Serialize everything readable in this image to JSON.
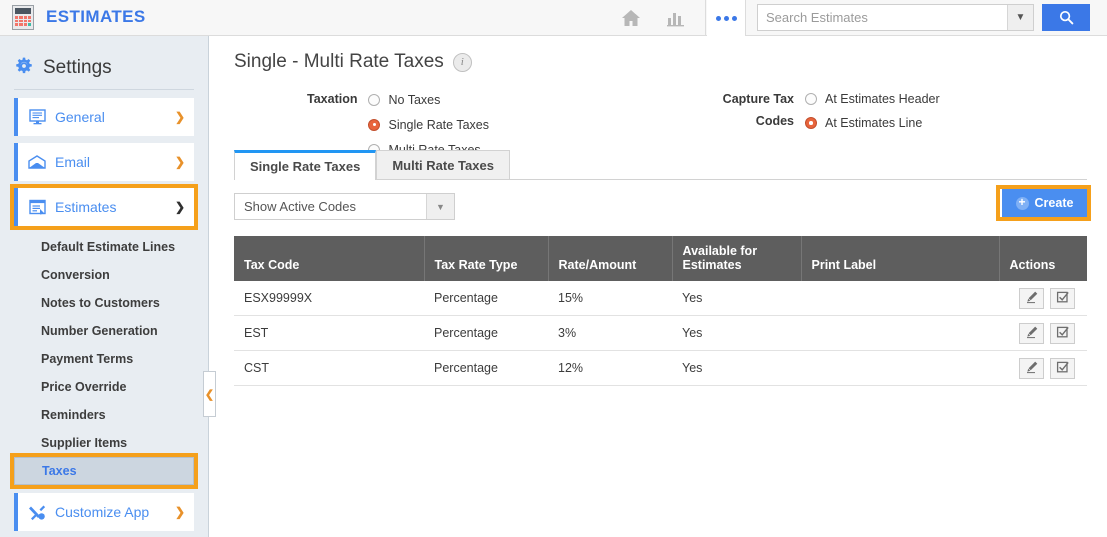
{
  "topbar": {
    "app_name": "ESTIMATES",
    "app_icon": "calculator-icon",
    "home_icon": "home-icon",
    "reports_icon": "bar-chart-icon",
    "more_icon": "more-dots-icon",
    "search": {
      "placeholder": "Search Estimates",
      "value": "",
      "dropdown_icon": "chevron-down-icon",
      "button_icon": "search-icon"
    },
    "accent_blue": "#3b78e7"
  },
  "sidebar": {
    "title": "Settings",
    "title_icon": "gear-icon",
    "nav": [
      {
        "label": "General",
        "icon": "monitor-icon",
        "arrow": "chevron-right-icon",
        "highlighted": false
      },
      {
        "label": "Email",
        "icon": "envelope-icon",
        "arrow": "chevron-right-icon",
        "highlighted": false
      },
      {
        "label": "Estimates",
        "icon": "document-form-icon",
        "arrow": "chevron-down-icon",
        "highlighted": true
      }
    ],
    "sub_items": [
      {
        "label": "Default Estimate Lines",
        "active": false
      },
      {
        "label": "Conversion",
        "active": false
      },
      {
        "label": "Notes to Customers",
        "active": false
      },
      {
        "label": "Number Generation",
        "active": false
      },
      {
        "label": "Payment Terms",
        "active": false
      },
      {
        "label": "Price Override",
        "active": false
      },
      {
        "label": "Reminders",
        "active": false
      },
      {
        "label": "Supplier Items",
        "active": false
      },
      {
        "label": "Taxes",
        "active": true
      }
    ],
    "footer_nav": {
      "label": "Customize App",
      "icon": "tools-icon",
      "arrow": "chevron-right-icon"
    },
    "collapse_icon": "chevron-left-icon",
    "highlight_color": "#f5a01b"
  },
  "main": {
    "page_title": "Single - Multi Rate Taxes",
    "info_icon": "info-icon",
    "info_glyph": "i",
    "taxation": {
      "label": "Taxation",
      "options": [
        {
          "label": "No Taxes",
          "selected": false
        },
        {
          "label": "Single Rate Taxes",
          "selected": true
        },
        {
          "label": "Multi Rate Taxes",
          "selected": false
        }
      ]
    },
    "capture_tax_codes": {
      "label_line1": "Capture Tax",
      "label_line2": "Codes",
      "options": [
        {
          "label": "At Estimates Header",
          "selected": false
        },
        {
          "label": "At Estimates Line",
          "selected": true
        }
      ]
    },
    "tabs": [
      {
        "label": "Single Rate Taxes",
        "active": true
      },
      {
        "label": "Multi Rate Taxes",
        "active": false
      }
    ],
    "filter": {
      "value": "Show Active Codes",
      "caret_icon": "caret-down-icon"
    },
    "create_button": {
      "label": "Create",
      "icon": "plus-circle-icon",
      "highlighted": true
    },
    "table": {
      "columns": [
        "Tax Code",
        "Tax Rate Type",
        "Rate/Amount",
        "Available for Estimates",
        "Print Label",
        "Actions"
      ],
      "column_avail_line1": "Available for",
      "column_avail_line2": "Estimates",
      "rows": [
        {
          "tax_code": "ESX99999X",
          "tax_rate_type": "Percentage",
          "rate_amount": "15%",
          "available": "Yes",
          "print_label": ""
        },
        {
          "tax_code": "EST",
          "tax_rate_type": "Percentage",
          "rate_amount": "3%",
          "available": "Yes",
          "print_label": ""
        },
        {
          "tax_code": "CST",
          "tax_rate_type": "Percentage",
          "rate_amount": "12%",
          "available": "Yes",
          "print_label": ""
        }
      ],
      "row_actions": [
        {
          "icon": "pencil-edit-icon"
        },
        {
          "icon": "checkbox-check-icon"
        }
      ],
      "header_bg": "#5e5e5e"
    }
  }
}
